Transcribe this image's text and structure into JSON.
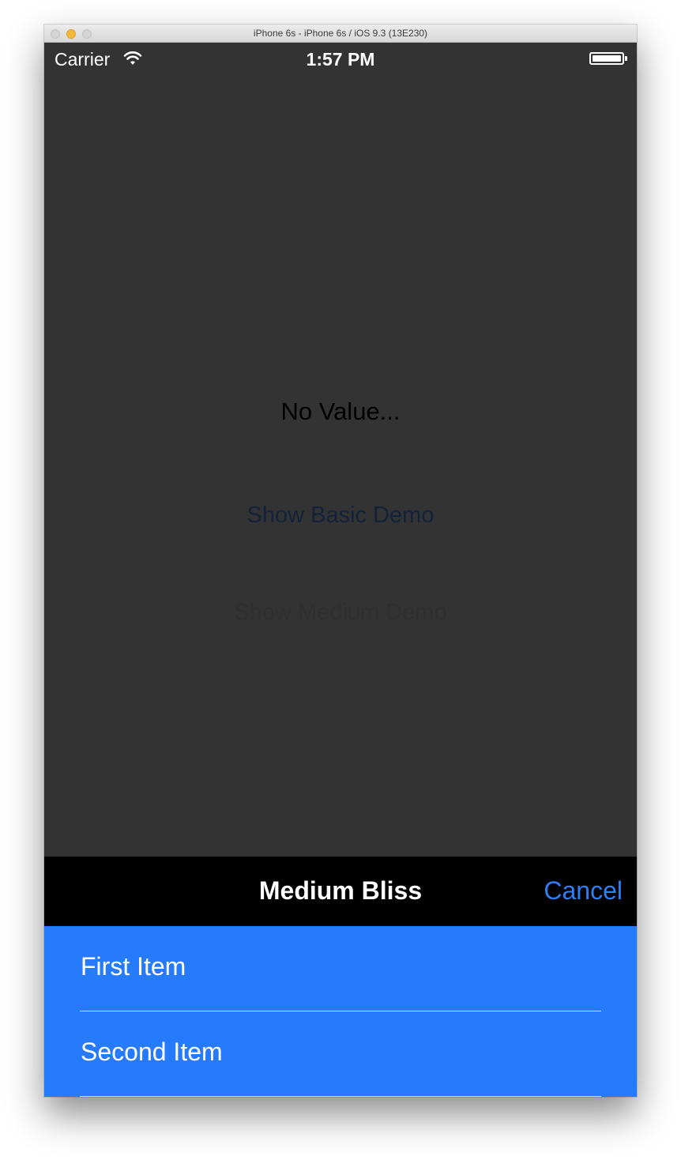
{
  "window": {
    "title": "iPhone 6s - iPhone 6s / iOS 9.3 (13E230)"
  },
  "status_bar": {
    "carrier": "Carrier",
    "time": "1:57 PM",
    "icons": [
      "wifi-icon",
      "battery-icon"
    ]
  },
  "main": {
    "value_label": "No Value...",
    "basic_demo_label": "Show Basic Demo",
    "medium_demo_label": "Show Medium Demo"
  },
  "sheet": {
    "title": "Medium Bliss",
    "cancel_label": "Cancel",
    "items": [
      {
        "label": "First Item"
      },
      {
        "label": "Second Item"
      }
    ],
    "colors": {
      "header_bg": "#000000",
      "list_bg": "#267bfd",
      "cancel": "#2d7ff5"
    }
  }
}
